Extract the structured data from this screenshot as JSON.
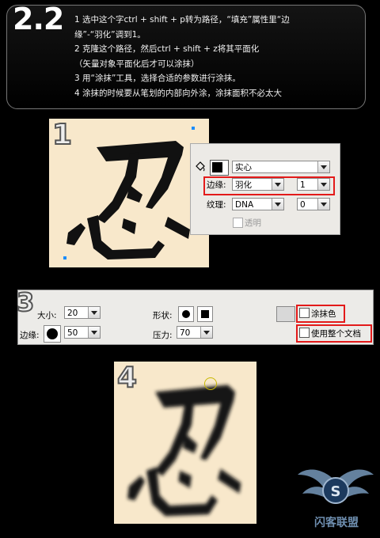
{
  "header": {
    "step": "2.2",
    "lines": [
      "1 选中这个字ctrl + shift + p转为路径，“填充”属性里“边",
      "缘”-“羽化”调到1。",
      "2 克隆这个路径，然后ctrl + shift + z将其平面化",
      "（矢量对象平面化后才可以涂抹）",
      "3 用“涂抹”工具，选择合适的参数进行涂抹。",
      "4 涂抹的时候要从笔划的内部向外涂，涂抹面积不必太大"
    ]
  },
  "panel1": {
    "number": "1",
    "character": "忍",
    "bg_color": "#f8e8cb"
  },
  "fill_panel": {
    "fill_type": "实心",
    "edge_label": "边缘:",
    "edge_value": "羽化",
    "edge_amount": "1",
    "texture_label": "纹理:",
    "texture_value": "DNA",
    "texture_amount": "0",
    "transparent_label": "透明",
    "icon": "paint-bucket-icon"
  },
  "toolbar": {
    "number": "3",
    "size_label": "大小:",
    "size_value": "20",
    "edge_label": "边缘:",
    "edge_value": "50",
    "shape_label": "形状:",
    "pressure_label": "压力:",
    "pressure_value": "70",
    "smear_color_label": "涂抹色",
    "whole_doc_label": "使用整个文档"
  },
  "panel4": {
    "number": "4",
    "character": "忍"
  },
  "logo": {
    "text": "闪客联盟"
  },
  "colors": {
    "highlight": "#e31a1a",
    "handle": "#1a8cff",
    "paper": "#f8e8cb"
  }
}
